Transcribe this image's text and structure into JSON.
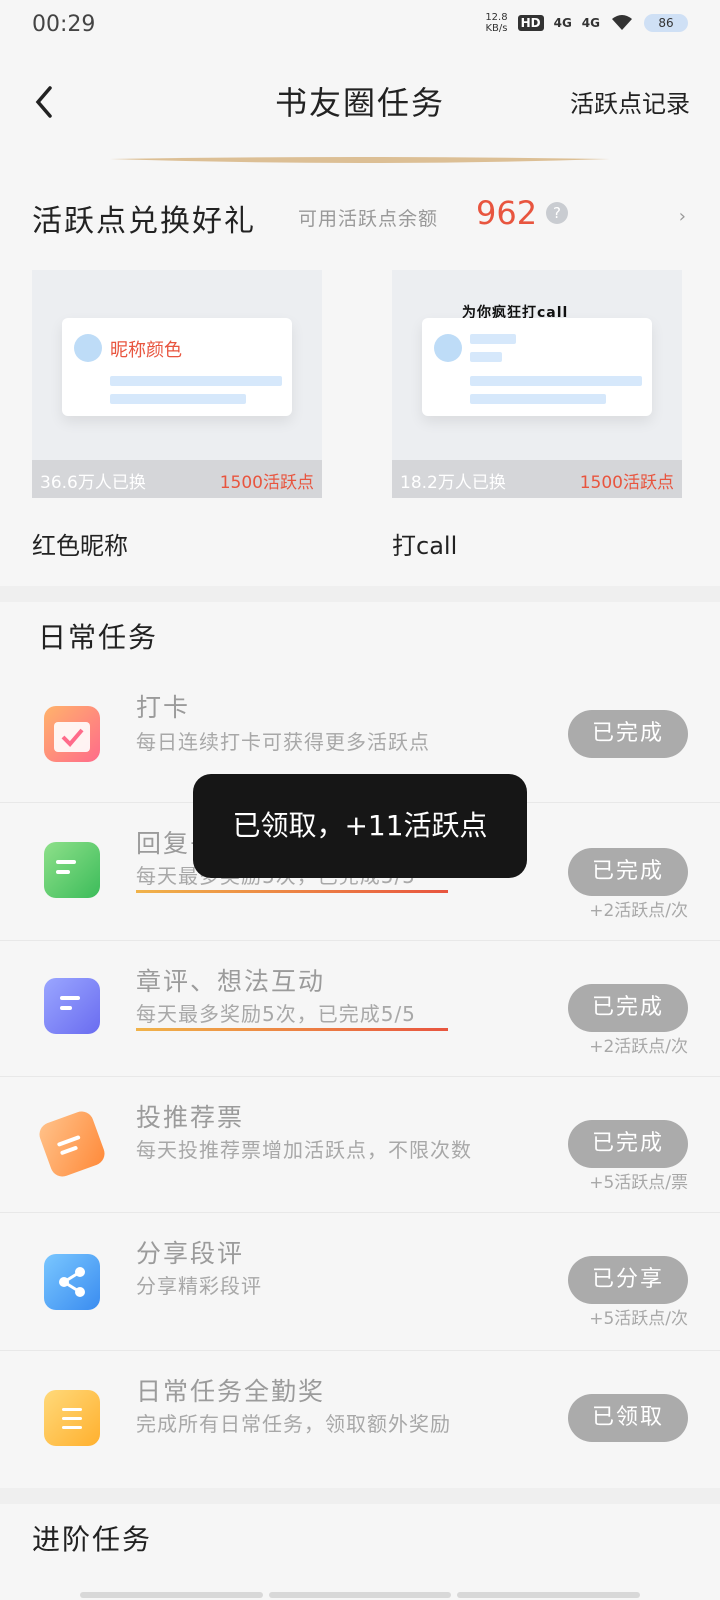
{
  "status_bar": {
    "time": "00:29",
    "speed_top": "12.8",
    "speed_unit": "KB/s",
    "hd": "HD",
    "sim1": "4G",
    "sim2": "4G",
    "battery": "86"
  },
  "nav": {
    "title": "书友圈任务",
    "right_link": "活跃点记录"
  },
  "redeem": {
    "title": "活跃点兑换好礼",
    "balance_label": "可用活跃点余额",
    "balance_value": "962",
    "help": "?",
    "items": [
      {
        "preview_text": "昵称颜色",
        "exchanged": "36.6万人已换",
        "cost": "1500活跃点",
        "name": "红色昵称"
      },
      {
        "preview_text": "为你疯狂打call",
        "exchanged": "18.2万人已换",
        "cost": "1500活跃点",
        "name": "打call"
      }
    ]
  },
  "daily": {
    "title": "日常任务",
    "tasks": [
      {
        "name": "打卡",
        "desc": "每日连续打卡可获得更多活跃点",
        "button": "已完成",
        "note": ""
      },
      {
        "name": "回复书评",
        "desc": "每天最多奖励5次，已完成5/5",
        "button": "已完成",
        "note": "+2活跃点/次"
      },
      {
        "name": "章评、想法互动",
        "desc": "每天最多奖励5次，已完成5/5",
        "button": "已完成",
        "note": "+2活跃点/次"
      },
      {
        "name": "投推荐票",
        "desc": "每天投推荐票增加活跃点，不限次数",
        "button": "已完成",
        "note": "+5活跃点/票"
      },
      {
        "name": "分享段评",
        "desc": "分享精彩段评",
        "button": "已分享",
        "note": "+5活跃点/次"
      },
      {
        "name": "日常任务全勤奖",
        "desc": "完成所有日常任务，领取额外奖励",
        "button": "已领取",
        "note": ""
      }
    ]
  },
  "advanced": {
    "title": "进阶任务"
  },
  "toast": {
    "text": "已领取，+11活跃点"
  },
  "colors": {
    "accent_red": "#e8553f",
    "button_gray": "#ababab"
  }
}
